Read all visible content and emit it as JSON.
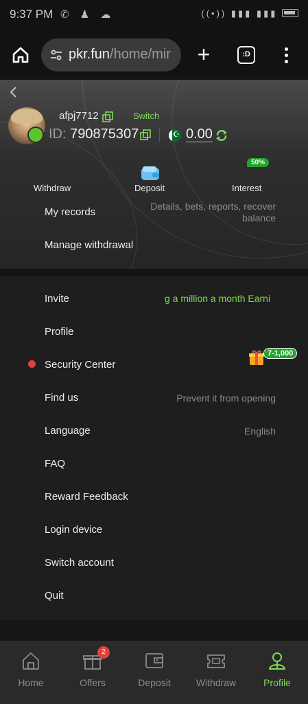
{
  "status_bar": {
    "time": "9:37 PM"
  },
  "browser": {
    "url_host": "pkr.fun",
    "url_path": "/home/mir",
    "tabs_count_label": ":D"
  },
  "profile": {
    "username": "afpj7712",
    "switch_label": "Switch",
    "id_label": "ID:",
    "id_value": "790875307",
    "balance": "0.00"
  },
  "quick_actions": {
    "withdraw": "Withdraw",
    "deposit": "Deposit",
    "interest": "Interest",
    "interest_badge": "50%"
  },
  "records": {
    "my_records": "My records",
    "my_records_hint_line1": "Details, bets, reports, recover",
    "my_records_hint_line2": "balance",
    "manage_withdrawal": "Manage withdrawal"
  },
  "menu": {
    "invite": "Invite",
    "invite_marquee": "g a million a month  Earni",
    "profile": "Profile",
    "security_center": "Security Center",
    "security_badge": "7-1,000",
    "find_us": "Find us",
    "find_us_hint": "Prevent it from opening",
    "language": "Language",
    "language_value": "English",
    "faq": "FAQ",
    "reward_feedback": "Reward Feedback",
    "login_device": "Login device",
    "switch_account": "Switch account",
    "quit": "Quit"
  },
  "bottom_nav": {
    "home": "Home",
    "offers": "Offers",
    "offers_badge": "2",
    "deposit": "Deposit",
    "withdraw": "Withdraw",
    "profile": "Profile"
  },
  "colors": {
    "accent_green": "#7ed957",
    "badge_green": "#22a32b",
    "alert_red": "#e0433a",
    "background": "#1e1e1e"
  }
}
